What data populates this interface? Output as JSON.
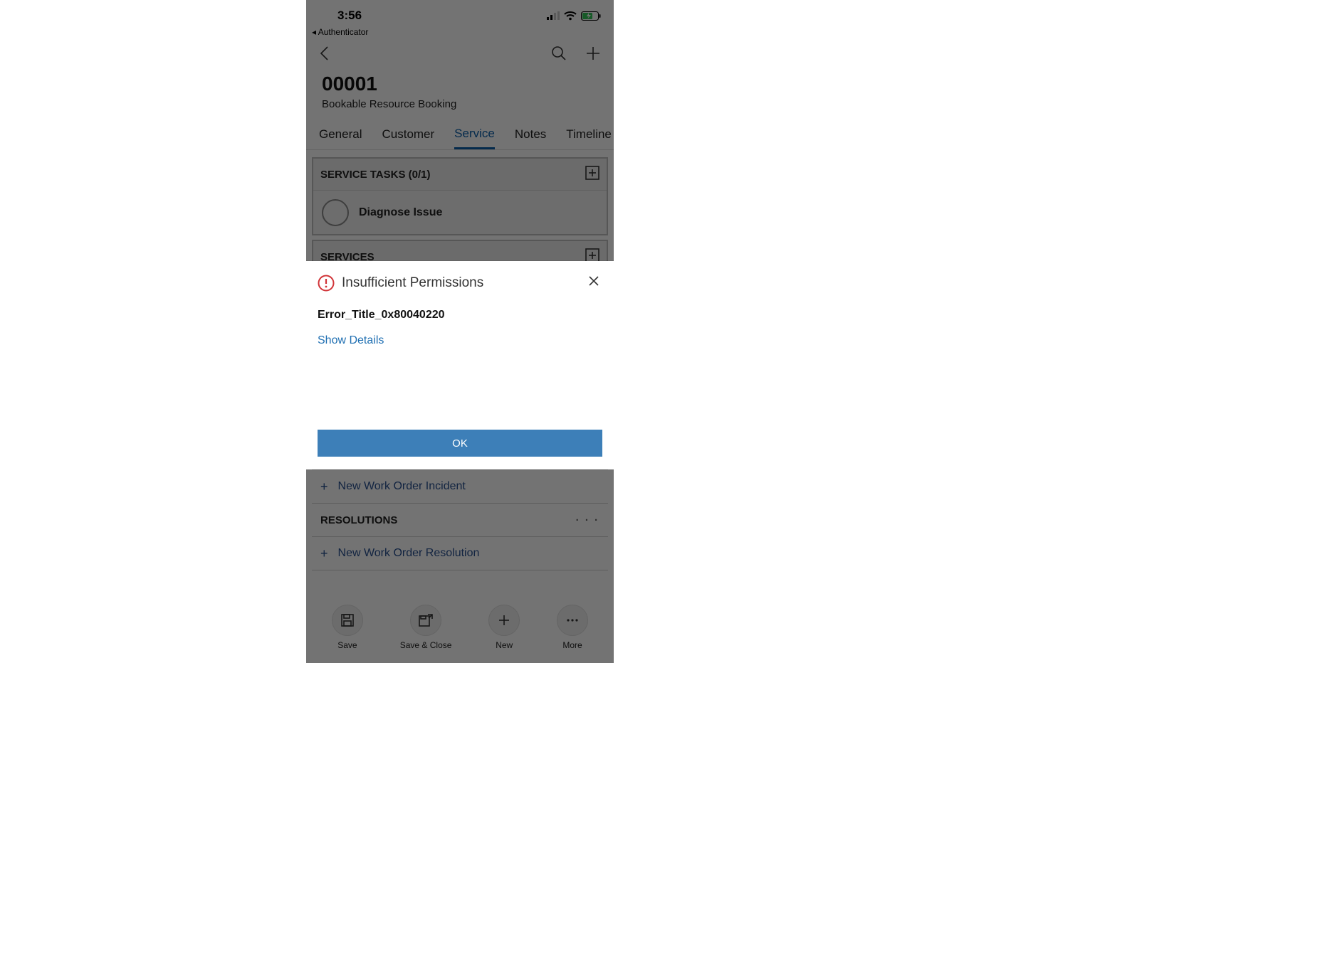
{
  "status_bar": {
    "time": "3:56",
    "back_app": "Authenticator"
  },
  "header": {
    "title": "00001",
    "subtitle": "Bookable Resource Booking"
  },
  "tabs": [
    "General",
    "Customer",
    "Service",
    "Notes",
    "Timeline"
  ],
  "active_tab_index": 2,
  "sections": {
    "service_tasks": {
      "header": "SERVICE TASKS (0/1)",
      "items": [
        "Diagnose Issue"
      ]
    },
    "services": {
      "header": "SERVICES"
    },
    "incidents_add": "New Work Order Incident",
    "resolutions": {
      "header": "RESOLUTIONS",
      "add": "New Work Order Resolution"
    }
  },
  "bottom_bar": {
    "save": "Save",
    "save_close": "Save & Close",
    "new": "New",
    "more": "More"
  },
  "modal": {
    "title": "Insufficient Permissions",
    "error_code": "Error_Title_0x80040220",
    "show_details": "Show Details",
    "ok": "OK"
  }
}
